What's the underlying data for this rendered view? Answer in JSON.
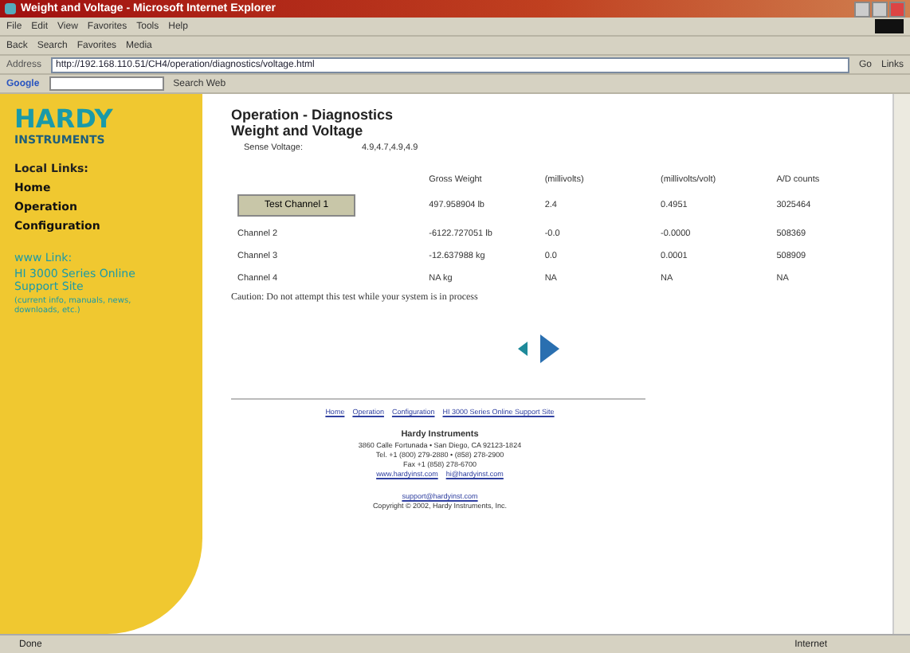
{
  "window": {
    "title": "Weight and Voltage - Microsoft Internet Explorer"
  },
  "menu": [
    "File",
    "Edit",
    "View",
    "Favorites",
    "Tools",
    "Help"
  ],
  "toolbar": [
    "Back",
    "Search",
    "Favorites",
    "Media"
  ],
  "address": {
    "label": "Address",
    "url": "http://192.168.110.51/CH4/operation/diagnostics/voltage.html",
    "go": "Go",
    "links": "Links"
  },
  "google_bar": {
    "logo": "Google",
    "search": "Search Web"
  },
  "sidebar": {
    "logo": "HARDY",
    "logo_sub": "INSTRUMENTS",
    "heading": "Local Links:",
    "items": [
      "Home",
      "Operation",
      "Configuration"
    ],
    "www_heading": "www Link:",
    "www_link": "HI 3000 Series Online Support Site",
    "www_note": "(current info, manuals, news, downloads, etc.)"
  },
  "page": {
    "title": "Operation - Diagnostics",
    "subtitle": "Weight and Voltage",
    "sense_label": "Sense Voltage:",
    "sense_value": "4.9,4.7,4.9,4.9"
  },
  "table": {
    "columns": [
      "Gross Weight",
      "(millivolts)",
      "(millivolts/volt)",
      "A/D counts"
    ],
    "rows": [
      {
        "kind": "button",
        "label": "Test Channel 1",
        "cells": [
          "497.958904 lb",
          "2.4",
          "0.4951",
          "3025464"
        ]
      },
      {
        "kind": "text",
        "label": "Channel 2",
        "cells": [
          "-6122.727051 lb",
          "-0.0",
          "-0.0000",
          "508369"
        ]
      },
      {
        "kind": "text",
        "label": "Channel 3",
        "cells": [
          "-12.637988 kg",
          "0.0",
          "0.0001",
          "508909"
        ]
      },
      {
        "kind": "text",
        "label": "Channel 4",
        "cells": [
          "NA kg",
          "NA",
          "NA",
          "NA"
        ]
      }
    ]
  },
  "caution": "Caution: Do not attempt this test while your system is in process",
  "footer": {
    "links": [
      "Home",
      "Operation",
      "Configuration",
      "HI 3000 Series Online Support Site"
    ],
    "company": "Hardy Instruments",
    "lines": [
      "3860 Calle Fortunada • San Diego, CA 92123-1824",
      "Tel. +1 (800) 279-2880 • (858) 278-2900",
      "Fax +1 (858) 278-6700"
    ],
    "web": "www.hardyinst.com",
    "email": "hi@hardyinst.com",
    "support": "support@hardyinst.com",
    "copyright": "Copyright © 2002, Hardy Instruments, Inc."
  },
  "status_bar": {
    "text": "Done",
    "zone": "Internet"
  }
}
